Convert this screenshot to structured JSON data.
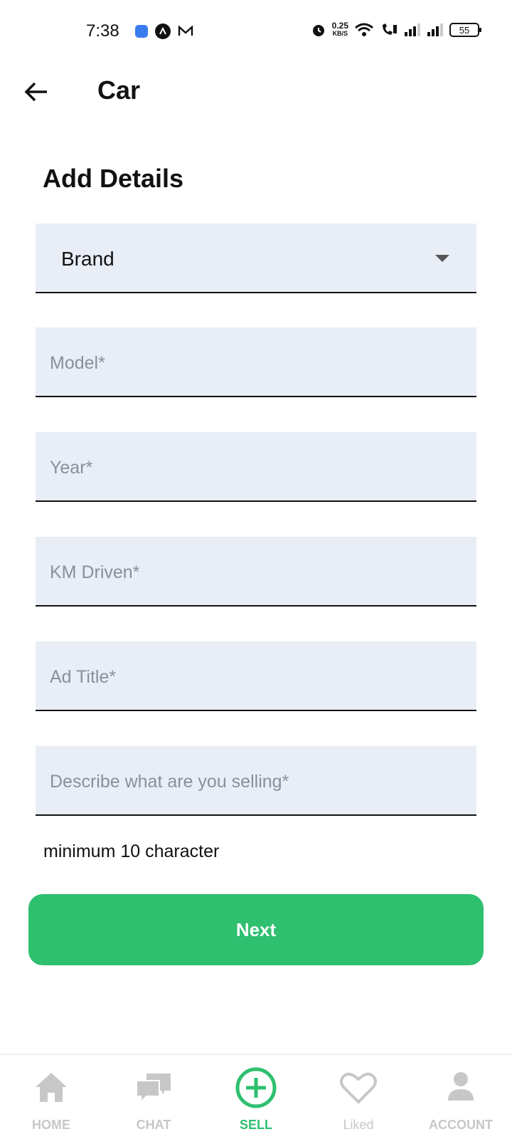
{
  "status_bar": {
    "time": "7:38",
    "net_speed_value": "0.25",
    "net_speed_unit": "KB/S",
    "battery": "55"
  },
  "app_bar": {
    "title": "Car"
  },
  "form": {
    "heading": "Add Details",
    "brand_label": "Brand",
    "model_placeholder": "Model*",
    "year_placeholder": "Year*",
    "km_placeholder": "KM Driven*",
    "ad_title_placeholder": "Ad Title*",
    "description_placeholder": "Describe what are you selling*",
    "description_helper": "minimum 10 character",
    "next_label": "Next"
  },
  "bottom_nav": {
    "items": [
      {
        "label": "HOME",
        "icon": "home-icon"
      },
      {
        "label": "CHAT",
        "icon": "chat-icon"
      },
      {
        "label": "SELL",
        "icon": "add-circle-icon"
      },
      {
        "label": "Liked",
        "icon": "heart-icon"
      },
      {
        "label": "ACCOUNT",
        "icon": "person-icon"
      }
    ],
    "active_index": 2
  },
  "colors": {
    "accent": "#2ebf6f",
    "field_bg": "#e9edf6",
    "inactive_nav": "#c7c7c7"
  }
}
